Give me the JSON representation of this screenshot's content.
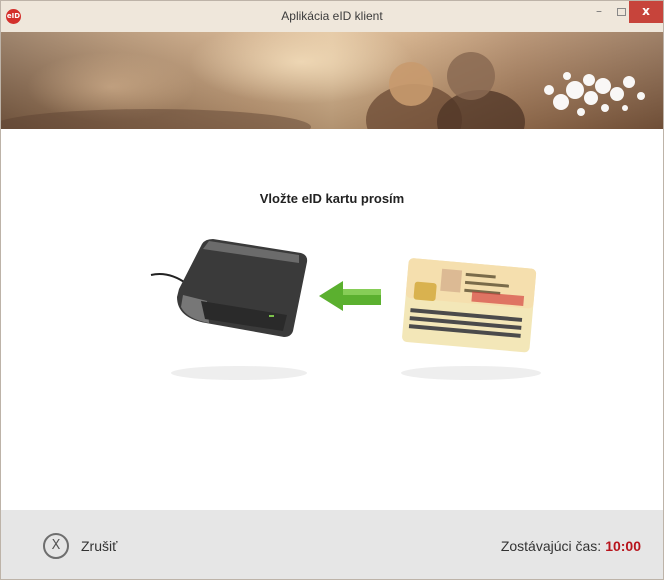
{
  "window": {
    "title": "Aplikácia eID klient",
    "app_icon_text": "eID",
    "controls": {
      "minimize": "–",
      "close": "x"
    }
  },
  "main": {
    "instruction": "Vložte eID kartu prosím"
  },
  "footer": {
    "cancel_icon_text": "X",
    "cancel_label": "Zrušiť",
    "timer_label": "Zostávajúci čas:",
    "timer_value": "10:00"
  },
  "colors": {
    "accent": "#b8141c",
    "arrow": "#5bb02f",
    "footer_bg": "#e6e6e6",
    "titlebar_bg": "#efe7db"
  },
  "icons": [
    "eid-app-icon",
    "minimize-icon",
    "maximize-icon",
    "close-icon",
    "cancel-x-icon",
    "card-reader-image",
    "insert-arrow-icon",
    "id-card-image"
  ]
}
